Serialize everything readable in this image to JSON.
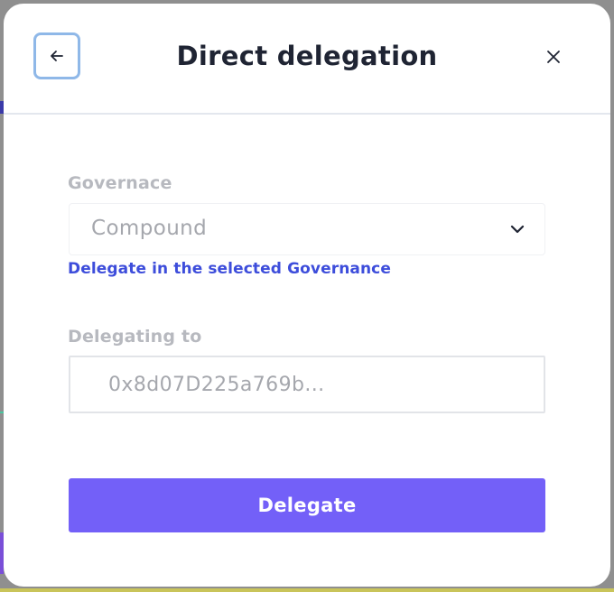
{
  "modal": {
    "title": "Direct delegation",
    "back_icon": "arrow-left-icon",
    "close_icon": "close-icon"
  },
  "governance": {
    "label": "Governace",
    "selected": "Compound",
    "dropdown_icon": "chevron-down-icon",
    "helper_text": "Delegate in the selected Governance"
  },
  "delegating_to": {
    "label": "Delegating to",
    "value": "0x8d07D225a769b..."
  },
  "actions": {
    "delegate_label": "Delegate"
  },
  "colors": {
    "accent": "#7360f8",
    "link": "#3d4ddb",
    "focus_ring": "#8fb8e8",
    "title": "#1f2433",
    "muted_label": "#b7b9bf"
  }
}
